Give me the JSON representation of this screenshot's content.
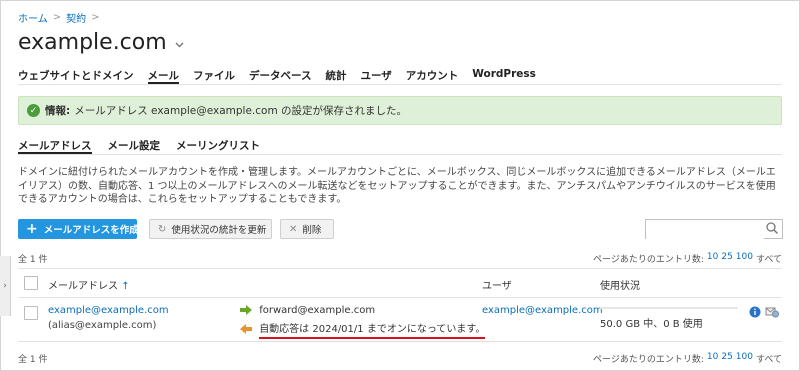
{
  "breadcrumb": {
    "home": "ホーム",
    "sep": ">",
    "contract": "契約"
  },
  "site": {
    "title": "example.com"
  },
  "main_tabs": [
    "ウェブサイトとドメイン",
    "メール",
    "ファイル",
    "データベース",
    "統計",
    "ユーザ",
    "アカウント",
    "WordPress"
  ],
  "alert": {
    "label": "情報:",
    "message": "メールアドレス example@example.com の設定が保存されました。"
  },
  "sub_tabs": [
    "メールアドレス",
    "メール設定",
    "メーリングリスト"
  ],
  "description": "ドメインに紐付けられたメールアカウントを作成・管理します。メールアカウントごとに、メールボックス、同じメールボックスに追加できるメールアドレス（メールエイリアス）の数、自動応答、1 つ以上のメールアドレスへのメール転送などをセットアップすることができます。また、アンチスパムやアンチウイルスのサービスを使用できるアカウントの場合は、これらをセットアップすることもできます。",
  "toolbar": {
    "create": "メールアドレスを作成",
    "update_stats": "使用状況の統計を更新",
    "delete": "削除"
  },
  "search": {
    "placeholder": ""
  },
  "list": {
    "count": "全 1 件",
    "per_page_label": "ページあたりのエントリ数:",
    "per_page_options": [
      "10",
      "25",
      "100",
      "すべて"
    ],
    "columns": {
      "email": "メールアドレス",
      "sort": "↑",
      "user": "ユーザ",
      "usage": "使用状況"
    },
    "rows": [
      {
        "email": "example@example.com",
        "alias": "(alias@example.com)",
        "forward": "forward@example.com",
        "autoreply": "自動応答は 2024/01/1 までオンになっています。",
        "user": "example@example.com",
        "usage": "50.0 GB 中、0 B 使用"
      }
    ]
  },
  "colors": {
    "link": "#0a6ebd",
    "primary": "#2496e0",
    "alert_bg": "#dff0d8",
    "underline": "#d8121a"
  }
}
